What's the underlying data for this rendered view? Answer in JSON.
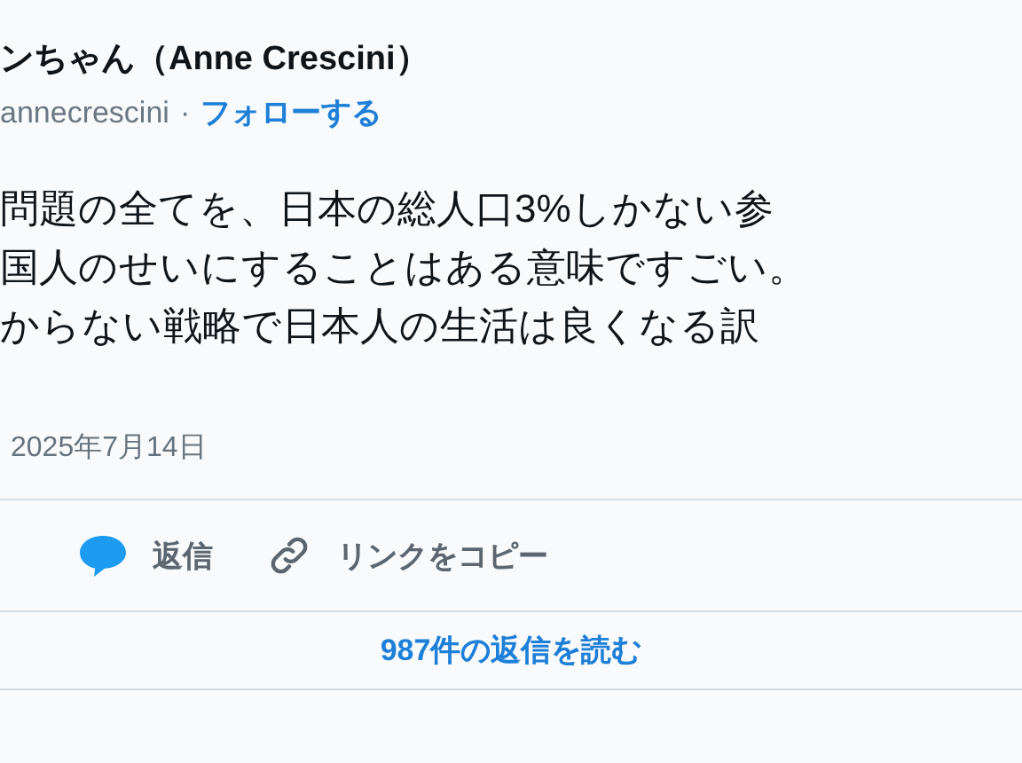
{
  "author": {
    "name": "ンちゃん（Anne Crescini）",
    "handle": "annecrescini",
    "separator": "·",
    "follow": "フォローする"
  },
  "body": {
    "lines": [
      "問題の全てを、日本の総人口3%しかない参",
      "国人のせいにすることはある意味ですごい。",
      "からない戦略で日本人の生活は良くなる訳"
    ]
  },
  "date": "2025年7月14日",
  "actions": [
    {
      "kind": "reply",
      "label": "返信"
    },
    {
      "kind": "link",
      "label": "リンクをコピー"
    }
  ],
  "read_replies": "987件の返信を読む"
}
